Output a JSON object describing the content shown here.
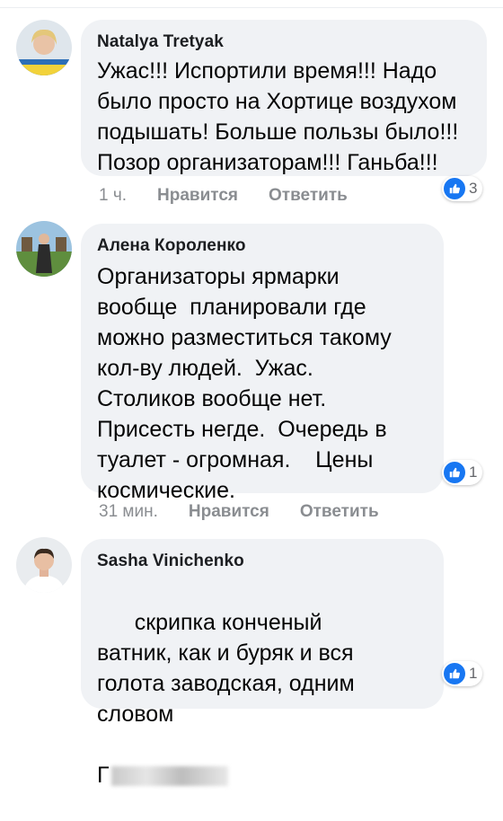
{
  "comments": [
    {
      "author": "Natalya Tretyak",
      "text": "Ужас!!! Испортили время!!! Надо было просто на Хортице воздухом подышать! Больше пользы было!!! Позор организаторам!!! Ганьба!!!",
      "time": "1 ч.",
      "like_label": "Нравится",
      "reply_label": "Ответить",
      "reaction_count": "3",
      "reaction_icon": "thumbs-up-icon"
    },
    {
      "author": "Алена Короленко",
      "text": "Организаторы ярмарки вообще  планировали где можно разместиться такому кол-ву людей.  Ужас. Столиков вообще нет. Присесть негде.  Очередь в туалет - огромная.    Цены космические.",
      "time": "31 мин.",
      "like_label": "Нравится",
      "reply_label": "Ответить",
      "reaction_count": "1",
      "reaction_icon": "thumbs-up-icon"
    },
    {
      "author": "Sasha  Vinichenko",
      "text": "скрипка конченый ватник, как и буряк и вся голота заводская, одним словом",
      "text_tail": "Г",
      "reaction_count": "1",
      "reaction_icon": "thumbs-up-icon"
    }
  ],
  "colors": {
    "bubble": "#f0f2f5",
    "like_blue": "#1877f2",
    "meta_gray": "#8a8d91"
  }
}
